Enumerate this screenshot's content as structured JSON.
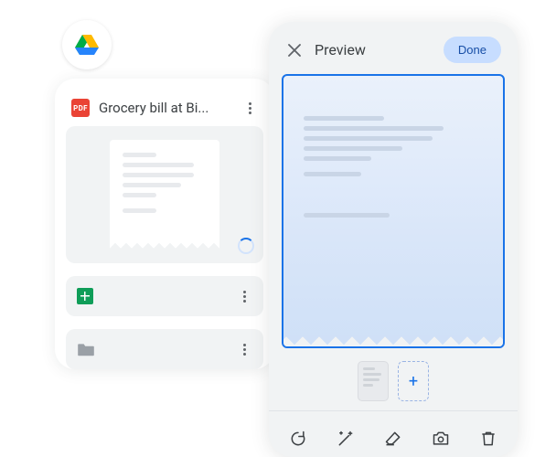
{
  "drive": {
    "logo_alt": "Google Drive"
  },
  "file": {
    "badge_label": "PDF",
    "title": "Grocery bill at Bi...",
    "status": "uploading"
  },
  "rows": [
    {
      "type": "sheets"
    },
    {
      "type": "folder"
    }
  ],
  "preview": {
    "title": "Preview",
    "done_label": "Done",
    "add_page_label": "+",
    "tools": {
      "retake": "Retake",
      "enhance": "Auto-enhance",
      "erase": "Eraser",
      "camera": "Camera",
      "delete": "Delete"
    }
  }
}
